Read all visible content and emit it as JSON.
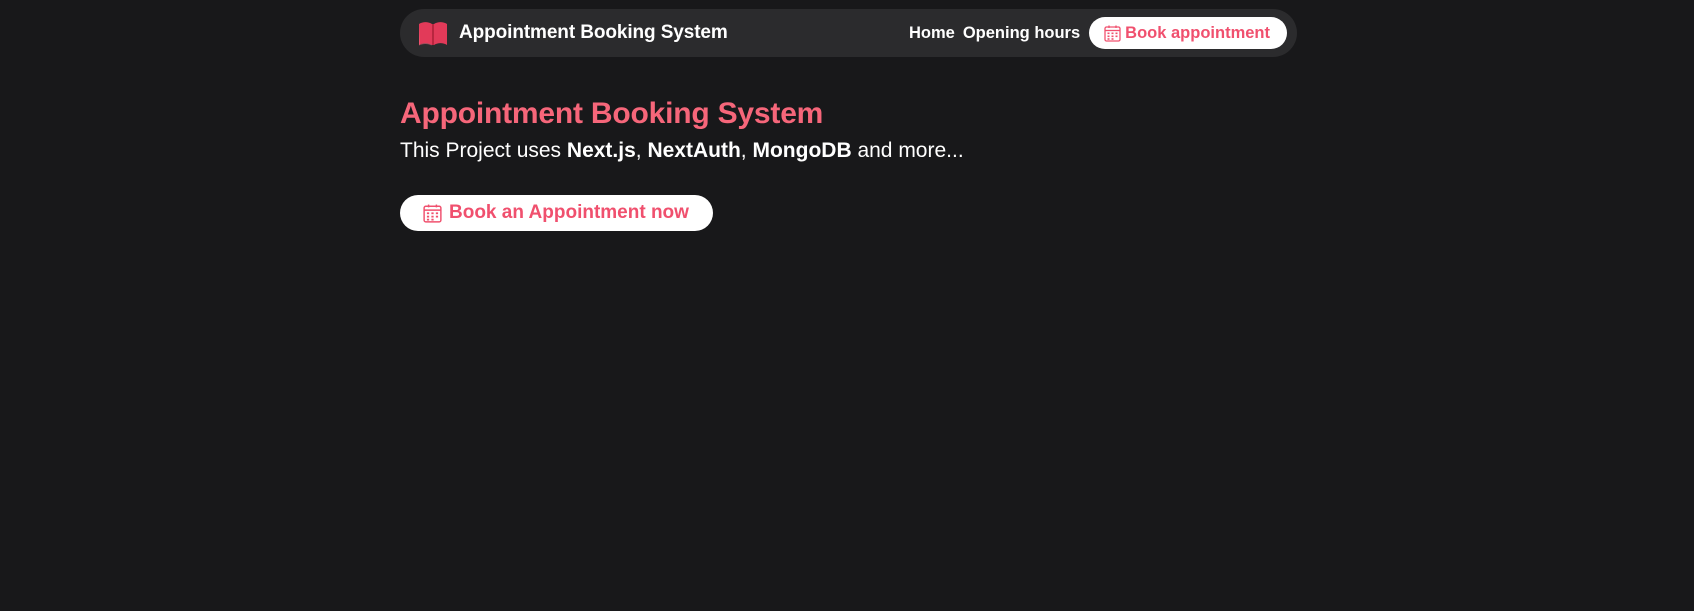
{
  "colors": {
    "background": "#18181a",
    "navbar": "#2b2b2d",
    "accent": "#f6667a",
    "button_text": "#f0506e",
    "button_bg": "#ffffff"
  },
  "navbar": {
    "brand_icon": "book-icon",
    "brand_title": "Appointment Booking System",
    "links": {
      "home": "Home",
      "opening_hours": "Opening hours"
    },
    "cta_icon": "calendar-icon",
    "cta_label": "Book appointment"
  },
  "hero": {
    "title": "Appointment Booking System",
    "description": {
      "prefix": "This Project uses ",
      "tech1": "Next.js",
      "sep1": ", ",
      "tech2": "NextAuth",
      "sep2": ", ",
      "tech3": "MongoDB",
      "suffix": " and more..."
    },
    "cta_icon": "calendar-icon",
    "cta_label": "Book an Appointment now"
  }
}
